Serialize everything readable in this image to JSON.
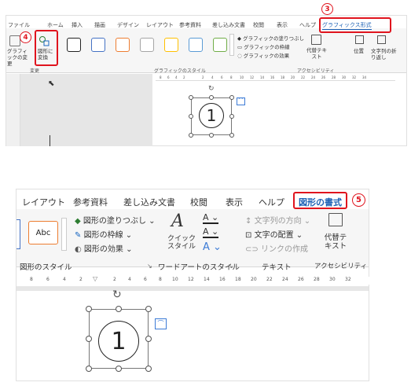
{
  "top": {
    "tabs": [
      "ファイル",
      "ホーム",
      "挿入",
      "描画",
      "デザイン",
      "レイアウト",
      "参考資料",
      "差し込み文書",
      "校閲",
      "表示",
      "ヘルプ",
      "グラフィックス形式"
    ],
    "callout_3": "3",
    "callout_4": "4",
    "change_graphic_label": "グラフィックの変更",
    "convert_shape_label": "図形に変換",
    "group_change": "変更",
    "fill_label": "グラフィックの塗りつぶし",
    "outline_label": "グラフィックの枠線",
    "effects_label": "グラフィックの効果",
    "group_graphic_style": "グラフィックのスタイル",
    "alt_text_label": "代替テキスト",
    "position_label": "位置",
    "wrap_label": "文字列の折り返し",
    "group_accessibility": "アクセシビリティ",
    "ruler": [
      "8",
      "6",
      "4",
      "2",
      "2",
      "4",
      "6",
      "8",
      "10",
      "12",
      "14",
      "16",
      "18",
      "20",
      "22",
      "24",
      "26",
      "28",
      "30",
      "32",
      "34"
    ],
    "shape_text": "1"
  },
  "bottom": {
    "tabs": [
      "レイアウト",
      "参考資料",
      "差し込み文書",
      "校閲",
      "表示",
      "ヘルプ",
      "図形の書式"
    ],
    "callout_5": "5",
    "style_sample": "Abc",
    "fill_label": "図形の塗りつぶし",
    "outline_label": "図形の枠線",
    "effects_label": "図形の効果",
    "group_shape_style": "図形のスタイル",
    "quick_style_label": "クイックスタイル",
    "group_wordart": "ワードアートのスタイル",
    "text_direction_label": "文字列の方向",
    "text_align_label": "文字の配置",
    "create_link_label": "リンクの作成",
    "group_text": "テキスト",
    "alt_text_label": "代替テキスト",
    "group_accessibility": "アクセシビリティ",
    "ruler": [
      "8",
      "6",
      "4",
      "2",
      "2",
      "4",
      "6",
      "8",
      "10",
      "12",
      "14",
      "16",
      "18",
      "20",
      "22",
      "24",
      "26",
      "28",
      "30",
      "32"
    ],
    "shape_text": "1"
  }
}
